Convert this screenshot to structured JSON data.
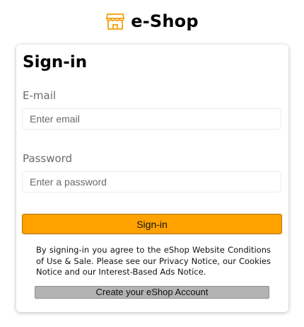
{
  "header": {
    "logo_icon": "storefront-icon",
    "logo_icon_color": "#f5a623",
    "title": "e-Shop"
  },
  "signin_form": {
    "title": "Sign-in",
    "email": {
      "label": "E-mail",
      "value": "",
      "placeholder": "Enter email"
    },
    "password": {
      "label": "Password",
      "value": "",
      "placeholder": "Enter a password"
    },
    "signin_button_label": "Sign-in",
    "terms_text": "By signing-in you agree to the eShop Website Conditions of Use & Sale. Please see our Privacy Notice, our Cookies Notice and our Interest-Based Ads Notice.",
    "create_account_label": "Create your eShop Account"
  },
  "colors": {
    "accent": "#ffa200",
    "secondary_button": "#b3b3b3",
    "label_text": "#6b6b6b"
  }
}
